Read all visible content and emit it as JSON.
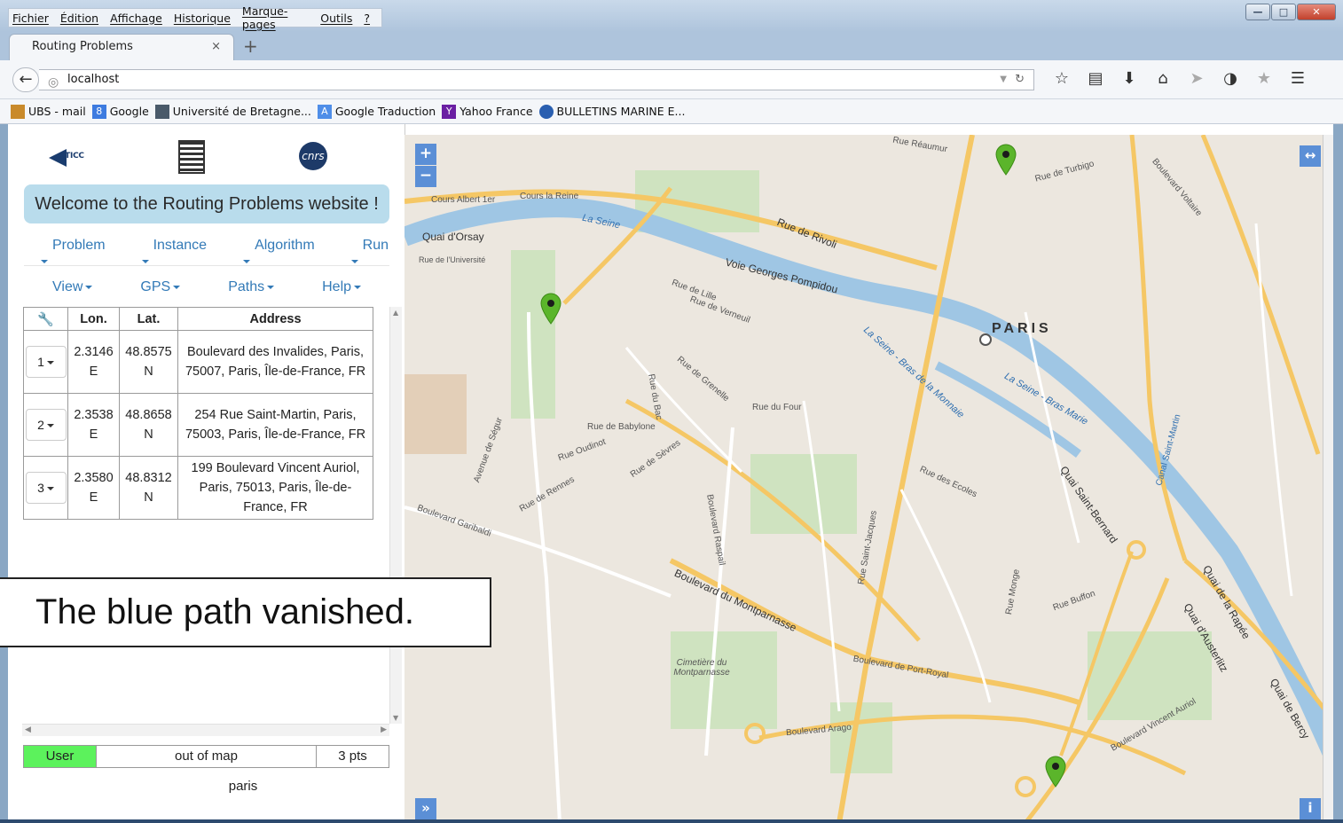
{
  "browser": {
    "menu": [
      "Fichier",
      "Édition",
      "Affichage",
      "Historique",
      "Marque-pages",
      "Outils",
      "?"
    ],
    "tab_title": "Routing Problems",
    "tab_close": "×",
    "new_tab": "+",
    "url": "localhost",
    "bookmarks": [
      {
        "label": "UBS - mail",
        "icon": "ubs-icon",
        "color": "#c98a2b"
      },
      {
        "label": "Google",
        "icon": "google-icon",
        "color": "#3d7be0"
      },
      {
        "label": "Université de Bretagne...",
        "icon": "univ-icon",
        "color": "#4a5a6a"
      },
      {
        "label": "Google Traduction",
        "icon": "translate-icon",
        "color": "#4f8ee8"
      },
      {
        "label": "Yahoo France",
        "icon": "yahoo-icon",
        "color": "#6b1fa3"
      },
      {
        "label": "BULLETINS MARINE E...",
        "icon": "marine-icon",
        "color": "#2a5fb0"
      }
    ]
  },
  "sidebar": {
    "welcome": "Welcome to the Routing Problems website !",
    "menu_row1": [
      "Problem",
      "Instance",
      "Algorithm",
      "Run"
    ],
    "menu_row2": [
      "View",
      "GPS",
      "Paths",
      "Help"
    ],
    "table": {
      "headers": [
        "Lon.",
        "Lat.",
        "Address"
      ],
      "rows": [
        {
          "index": "1",
          "lon": "2.3146 E",
          "lat": "48.8575 N",
          "address": "Boulevard des Invalides, Paris, 75007, Paris, Île-de-France, FR"
        },
        {
          "index": "2",
          "lon": "2.3538 E",
          "lat": "48.8658 N",
          "address": "254 Rue Saint-Martin, Paris, 75003, Paris, Île-de-France, FR"
        },
        {
          "index": "3",
          "lon": "2.3580 E",
          "lat": "48.8312 N",
          "address": "199 Boulevard Vincent Auriol, Paris, 75013, Paris, Île-de-France, FR"
        }
      ]
    },
    "status": {
      "mode": "User",
      "map_state": "out of map",
      "points": "3 pts"
    },
    "region": "paris"
  },
  "map": {
    "city": "PARIS",
    "zoom_in": "+",
    "zoom_out": "−",
    "labels": [
      "Cours Albert 1er",
      "Cours la Reine",
      "Quai d'Orsay",
      "Rue de l'Université",
      "La Seine",
      "Rue de Rivoli",
      "Voie Georges Pompidou",
      "Rue de Lille",
      "Rue de Verneuil",
      "Rue de Grenelle",
      "Rue de Babylone",
      "Rue de Sèvres",
      "Boulevard Raspail",
      "Boulevard du Montparnasse",
      "Cimetière du Montparnasse",
      "Boulevard de Port-Royal",
      "Boulevard Arago",
      "Rue Monge",
      "Quai Saint-Bernard",
      "Quai d'Austerlitz",
      "Quai de la Rapée",
      "Quai de Bercy",
      "Boulevard Vincent Auriol",
      "Rue Réaumur",
      "Rue de Turbigo",
      "Boulevard Voltaire",
      "Canal Saint-Martin",
      "Rue du Four",
      "Rue des Ecoles",
      "Boulevard Garibaldi",
      "Rue de Rennes",
      "Rue Saint-Jacques",
      "Rue Buffon",
      "La Seine - Bras de la Monnaie",
      "La Seine - Bras Marie",
      "Rue du Bac",
      "Avenue de Ségur",
      "Rue Oudinot"
    ]
  },
  "overlay": {
    "caption": "The blue path vanished."
  }
}
